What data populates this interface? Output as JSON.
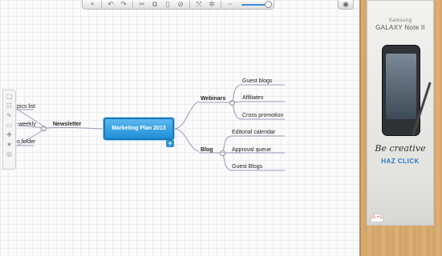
{
  "toolbar": {
    "add": "+",
    "undo": "↶",
    "redo": "↷",
    "cut": "✂",
    "copy": "⧉",
    "paste": "▯",
    "delete": "⊘",
    "expand": "⤧",
    "collapse": "✲",
    "zoom_out": "−",
    "zoom_level": 1.0
  },
  "view_button": "◉",
  "side_tools": [
    "▢",
    "☷",
    "✎",
    "▭",
    "✚",
    "★",
    "◎"
  ],
  "map": {
    "central": "Marketing Plan 2013",
    "add_label": "+",
    "left": {
      "branch": "Newsletter",
      "children": [
        "pics list",
        "-weekly",
        "o folder"
      ]
    },
    "right": [
      {
        "branch": "Webinars",
        "children": [
          "Guest blogs",
          "Affiliates",
          "Cross promotion"
        ]
      },
      {
        "branch": "Blog",
        "children": [
          "Editorial calendar",
          "Approval queue",
          "Guest Blogs"
        ]
      }
    ],
    "collapse_sign": "−"
  },
  "ad": {
    "brand": "Samsung",
    "model": "GALAXY Note II",
    "tagline": "Be creative",
    "cta": "HAZ CLICK",
    "badge": "G +1"
  },
  "colors": {
    "accent": "#1f8fd8",
    "cta": "#2a79c9"
  }
}
